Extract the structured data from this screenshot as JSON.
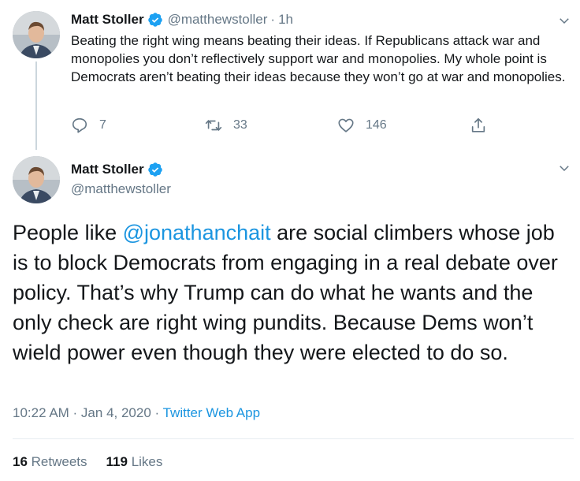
{
  "tweet1": {
    "author_name": "Matt Stoller",
    "handle": "@matthewstoller",
    "separator": "·",
    "time": "1h",
    "text": "Beating the right wing means beating their ideas. If Republicans attack war and monopolies you don’t reflectively support war and monopolies. My whole point is Democrats aren’t beating their ideas because they won’t go at war and monopolies.",
    "reply_count": "7",
    "retweet_count": "33",
    "like_count": "146"
  },
  "tweet2": {
    "author_name": "Matt Stoller",
    "handle": "@matthewstoller",
    "text_before": "People like ",
    "mention": "@jonathanchait",
    "text_after": " are social climbers whose job is to block Democrats from engaging in a real debate over policy. That’s why Trump can do what he wants and the only check are right wing pundits. Because Dems won’t wield power even though they were elected to do so.",
    "timestamp": "10:22 AM · Jan 4, 2020 · ",
    "app": "Twitter Web App",
    "retweets_value": "16",
    "retweets_label": "Retweets",
    "likes_value": "119",
    "likes_label": "Likes"
  },
  "icons": {
    "verified": "verified-badge-icon",
    "menu": "chevron-down-icon",
    "reply": "reply-icon",
    "retweet": "retweet-icon",
    "like": "heart-icon",
    "share": "share-icon"
  },
  "colors": {
    "link": "#1b95e0",
    "muted": "#657786",
    "text": "#14171a",
    "verified": "#1da1f2"
  }
}
